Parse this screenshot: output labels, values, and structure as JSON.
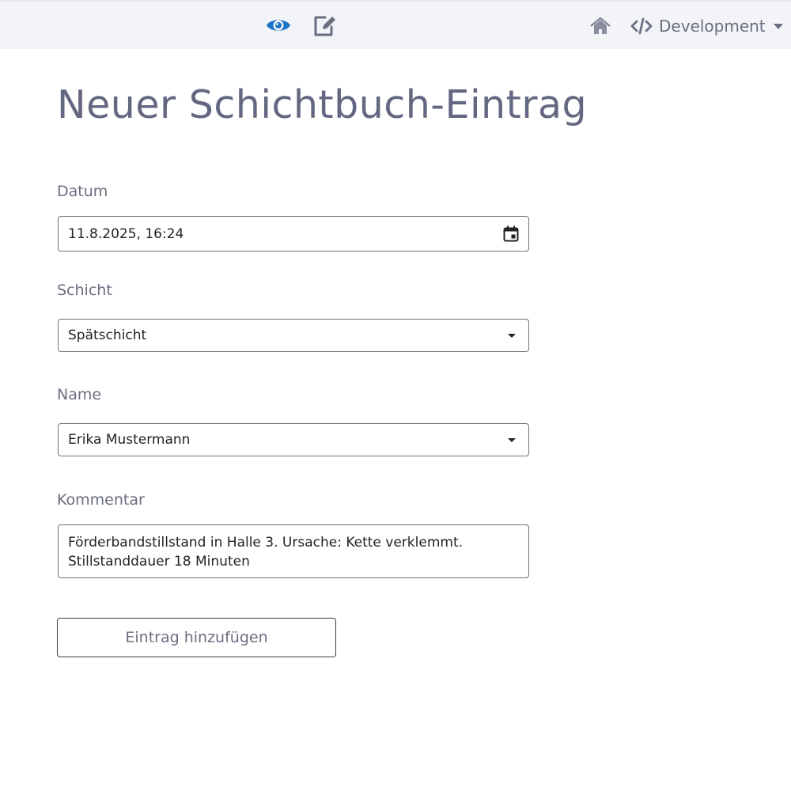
{
  "header": {
    "view_icon": "eye-icon",
    "edit_icon": "edit-icon",
    "home_icon": "home-icon",
    "env_icon": "code-icon",
    "environment_label": "Development",
    "accent_color": "#1a73c8"
  },
  "page": {
    "title": "Neuer Schichtbuch-Eintrag"
  },
  "form": {
    "date": {
      "label": "Datum",
      "value": "11.8.2025, 16:24",
      "icon": "calendar-icon"
    },
    "shift": {
      "label": "Schicht",
      "selected": "Spätschicht"
    },
    "name": {
      "label": "Name",
      "selected": "Erika Mustermann"
    },
    "comment": {
      "label": "Kommentar",
      "value": "Förderbandstillstand in Halle 3. Ursache: Kette verklemmt.\nStillstanddauer 18 Minuten"
    },
    "submit_label": "Eintrag hinzufügen"
  }
}
